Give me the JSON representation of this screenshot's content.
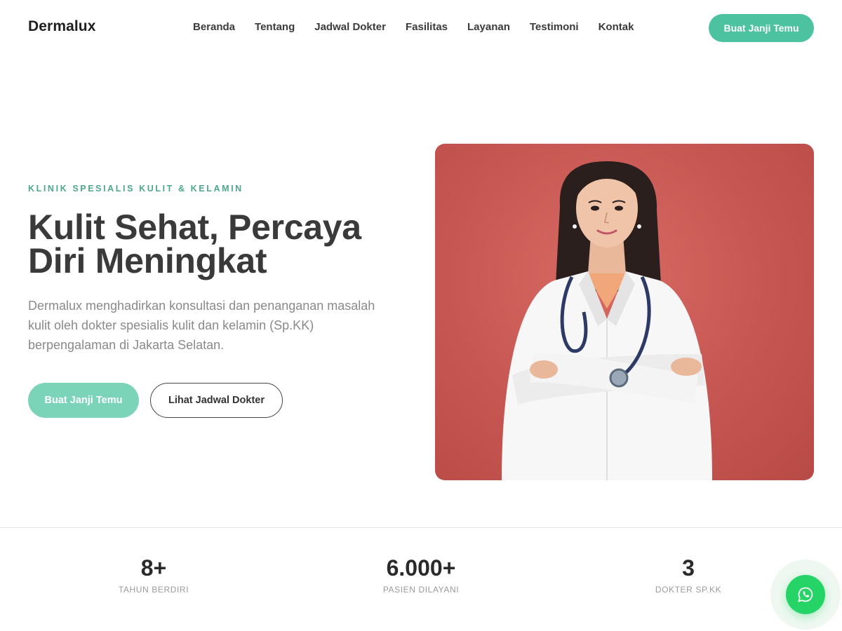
{
  "nav": {
    "brand": "Dermalux",
    "items": [
      {
        "label": "Beranda"
      },
      {
        "label": "Tentang"
      },
      {
        "label": "Jadwal Dokter"
      },
      {
        "label": "Fasilitas"
      },
      {
        "label": "Layanan"
      },
      {
        "label": "Testimoni"
      },
      {
        "label": "Kontak"
      }
    ],
    "cta_label": "Buat Janji Temu"
  },
  "hero": {
    "eyebrow": "KLINIK SPESIALIS KULIT & KELAMIN",
    "headline": "Kulit Sehat, Percaya Diri Meningkat",
    "description": "Dermalux menghadirkan konsultasi dan penanganan masalah kulit oleh dokter spesialis kulit dan kelamin (Sp.KK) berpengalaman di Jakarta Selatan.",
    "primary_cta": "Buat Janji Temu",
    "secondary_cta": "Lihat Jadwal Dokter"
  },
  "stats": [
    {
      "value": "8+",
      "label": "TAHUN BERDIRI"
    },
    {
      "value": "6.000+",
      "label": "PASIEN DILAYANI"
    },
    {
      "value": "3",
      "label": "DOKTER SP.KK"
    }
  ],
  "colors": {
    "accent": "#4cc2a0",
    "eyebrow": "#4ea88a",
    "whatsapp": "#25d366",
    "photo_background": "#c65651"
  },
  "icons": {
    "floating_button": "whatsapp-icon"
  }
}
